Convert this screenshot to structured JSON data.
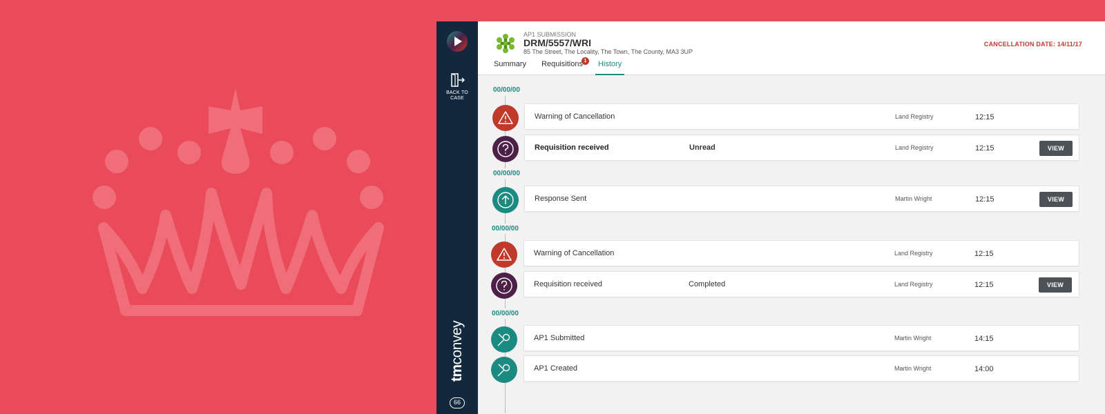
{
  "colors": {
    "background": "#ea4b5a",
    "sidebar": "#13283d",
    "accent_teal": "#1b8a80",
    "alert_red": "#c0392b",
    "query_purple": "#4d2048",
    "button_dark": "#4d5256"
  },
  "sidebar": {
    "back_label": "BACK TO CASE",
    "back_icon": "exit-door-icon",
    "brand": {
      "prefix": "tm",
      "suffix": "convey"
    },
    "badge": "66"
  },
  "header": {
    "kicker": "AP1 SUBMISSION",
    "reference": "DRM/5557/WRI",
    "address": "85 The Street, The Locality, The Town, The County, MA3 3UP",
    "cancellation_date": "CANCELLATION DATE: 14/11/17"
  },
  "tabs": [
    {
      "label": "Summary",
      "active": false
    },
    {
      "label": "Requisitions",
      "badge": "1",
      "active": false
    },
    {
      "label": "History",
      "active": true
    }
  ],
  "timeline": {
    "dates": [
      "00/00/00",
      "00/00/00",
      "00/00/00",
      "00/00/00"
    ],
    "events": [
      {
        "icon": "warning-icon",
        "title": "Warning of Cancellation",
        "status": "",
        "by": "Land Registry",
        "time": "12:15",
        "action": ""
      },
      {
        "icon": "question-icon",
        "title": "Requisition received",
        "status": "Unread",
        "by": "Land Registry",
        "time": "12:15",
        "action": "VIEW"
      },
      {
        "icon": "upload-arrow-icon",
        "title": "Response Sent",
        "status": "",
        "by": "Martin Wright",
        "time": "12:15",
        "action": "VIEW"
      },
      {
        "icon": "warning-icon",
        "title": "Warning of Cancellation",
        "status": "",
        "by": "Land Registry",
        "time": "12:15",
        "action": ""
      },
      {
        "icon": "question-icon",
        "title": "Requisition received",
        "status": "Completed",
        "by": "Land Registry",
        "time": "12:15",
        "action": "VIEW"
      },
      {
        "icon": "pen-nib-icon",
        "title": "AP1 Submitted",
        "status": "",
        "by": "Martin Wright",
        "time": "14:15",
        "action": ""
      },
      {
        "icon": "pen-nib-icon",
        "title": "AP1 Created",
        "status": "",
        "by": "Martin Wright",
        "time": "14:00",
        "action": ""
      }
    ]
  }
}
